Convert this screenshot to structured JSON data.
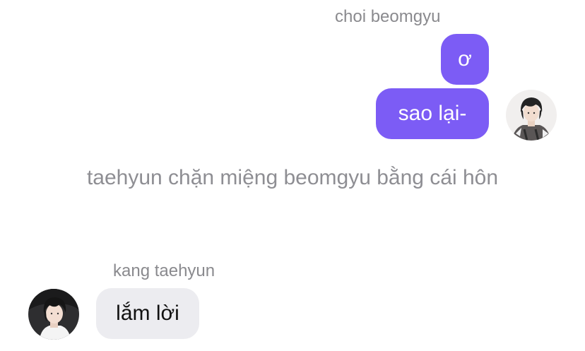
{
  "outgoing_sender": {
    "name": "choi beomgyu",
    "messages": [
      "ơ",
      "sao lại-"
    ]
  },
  "narration": "taehyun chặn miệng beomgyu bằng cái hôn",
  "incoming_sender": {
    "name": "kang taehyun",
    "messages": [
      "lắm lời"
    ]
  },
  "colors": {
    "outgoing_bubble": "#7c5cf5",
    "incoming_bubble": "#ececf0",
    "name_text": "#8a8a8e"
  }
}
